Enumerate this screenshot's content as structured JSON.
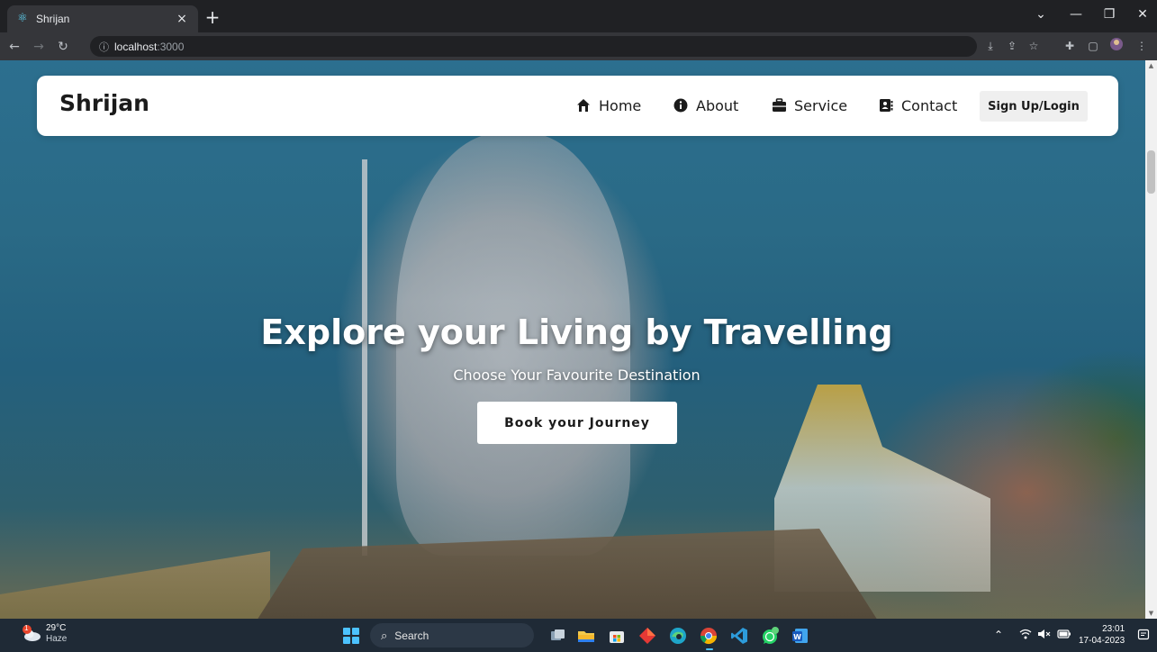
{
  "browser": {
    "tab_title": "Shrijan",
    "tab_favicon": "react-atom-icon",
    "url_host": "localhost",
    "url_port": ":3000",
    "window_controls": {
      "minimize": "—",
      "restore": "❐",
      "close": "✕"
    }
  },
  "navbar": {
    "brand": "Shrijan",
    "items": [
      {
        "label": "Home",
        "icon": "home-icon"
      },
      {
        "label": "About",
        "icon": "info-icon"
      },
      {
        "label": "Service",
        "icon": "briefcase-icon"
      },
      {
        "label": "Contact",
        "icon": "address-book-icon"
      }
    ],
    "signup_label": "Sign Up/Login"
  },
  "hero": {
    "title": "Explore your Living by Travelling",
    "subtitle": "Choose Your Favourite Destination",
    "cta_label": "Book your Journey"
  },
  "taskbar": {
    "weather_badge": "1",
    "weather_temp": "29°C",
    "weather_condition": "Haze",
    "search_label": "Search",
    "time": "23:01",
    "date": "17-04-2023"
  },
  "colors": {
    "brand_text": "#1b1b1b",
    "navbar_bg": "#ffffff",
    "browser_dark": "#202124",
    "taskbar_bg": "#1f2a36",
    "accent_blue": "#4cc2ff"
  }
}
